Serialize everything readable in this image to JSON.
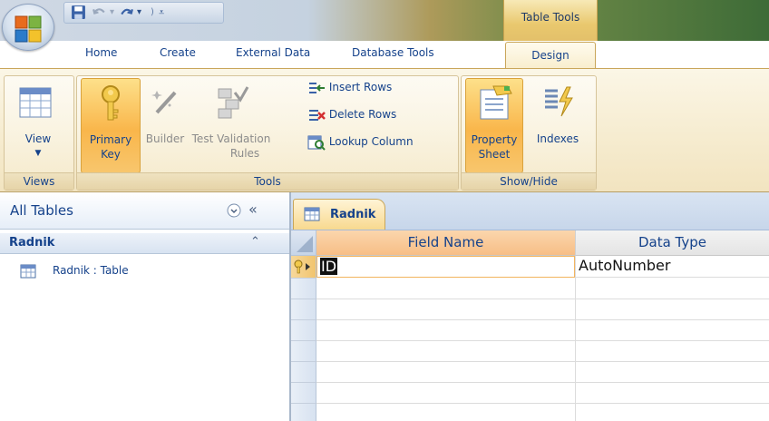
{
  "title_bar": {
    "contextual_tab_group": "Table Tools"
  },
  "ribbon_tabs": [
    "Home",
    "Create",
    "External Data",
    "Database Tools",
    "Design"
  ],
  "ribbon": {
    "groups": {
      "views": {
        "label": "Views",
        "view_label": "View"
      },
      "tools": {
        "label": "Tools",
        "primary_key_line1": "Primary",
        "primary_key_line2": "Key",
        "builder": "Builder",
        "test_validation_line1": "Test Validation",
        "test_validation_line2": "Rules",
        "insert_rows": "Insert Rows",
        "delete_rows": "Delete Rows",
        "lookup_column": "Lookup Column"
      },
      "show_hide": {
        "label": "Show/Hide",
        "property_sheet_line1": "Property",
        "property_sheet_line2": "Sheet",
        "indexes": "Indexes"
      }
    }
  },
  "nav_pane": {
    "title": "All Tables",
    "collapse_symbol": "«",
    "group_label": "Radnik",
    "item_label": "Radnik : Table"
  },
  "document": {
    "tab_label": "Radnik",
    "columns": [
      "Field Name",
      "Data Type"
    ],
    "rows": [
      {
        "field_name": "ID",
        "data_type": "AutoNumber",
        "primary_key": true
      }
    ]
  },
  "colors": {
    "active_orange": "#f9b64b",
    "header_orange": "#f9c998",
    "ribbon_text": "#15428b"
  },
  "icons": [
    "office-logo-icon",
    "save-icon",
    "undo-icon",
    "redo-icon",
    "table-view-icon",
    "primary-key-icon",
    "builder-wand-icon",
    "test-validation-icon",
    "insert-rows-icon",
    "delete-rows-icon",
    "lookup-column-icon",
    "property-sheet-icon",
    "indexes-icon",
    "table-icon",
    "key-row-icon",
    "chevron-circle-icon",
    "double-chevron-up-icon"
  ]
}
